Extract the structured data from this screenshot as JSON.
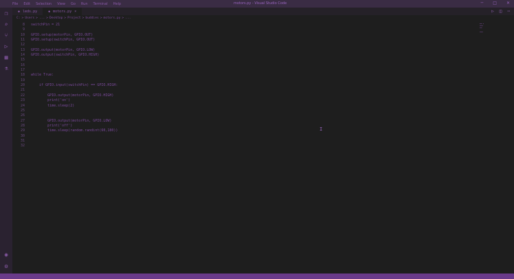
{
  "titlebar": {
    "menu": [
      "File",
      "Edit",
      "Selection",
      "View",
      "Go",
      "Run",
      "Terminal",
      "Help"
    ],
    "title": "motors.py - Visual Studio Code",
    "buttons": [
      "─",
      "□",
      "✕"
    ]
  },
  "tabs": [
    {
      "label": "leds.py",
      "active": false
    },
    {
      "label": "motors.py",
      "active": true
    }
  ],
  "breadcrumb": [
    "C:",
    "Users",
    "...",
    "Desktop",
    "Project",
    "buddies",
    "motors.py",
    "..."
  ],
  "editor": {
    "lines": [
      {
        "n": "8",
        "t": "switchPin = 21"
      },
      {
        "n": "9",
        "t": ""
      },
      {
        "n": "10",
        "t": "GPIO.setup(motorPin, GPIO.OUT)"
      },
      {
        "n": "11",
        "t": "GPIO.setup(switchPin, GPIO.OUT)"
      },
      {
        "n": "12",
        "t": ""
      },
      {
        "n": "13",
        "t": "GPIO.output(motorPin, GPIO.LOW)"
      },
      {
        "n": "14",
        "t": "GPIO.output(switchPin, GPIO.HIGH)"
      },
      {
        "n": "15",
        "t": ""
      },
      {
        "n": "16",
        "t": ""
      },
      {
        "n": "17",
        "t": ""
      },
      {
        "n": "18",
        "t": "while True:"
      },
      {
        "n": "19",
        "t": ""
      },
      {
        "n": "20",
        "t": "    if GPIO.input(switchPin) == GPIO.HIGH:"
      },
      {
        "n": "21",
        "t": ""
      },
      {
        "n": "22",
        "t": "        GPIO.output(motorPin, GPIO.HIGH)"
      },
      {
        "n": "23",
        "t": "        print('on')"
      },
      {
        "n": "24",
        "t": "        time.sleep(2)"
      },
      {
        "n": "25",
        "t": ""
      },
      {
        "n": "26",
        "t": ""
      },
      {
        "n": "27",
        "t": "        GPIO.output(motorPin, GPIO.LOW)"
      },
      {
        "n": "28",
        "t": "        print('off')"
      },
      {
        "n": "29",
        "t": "        time.sleep(random.randint(60,180))"
      },
      {
        "n": "30",
        "t": ""
      },
      {
        "n": "31",
        "t": ""
      },
      {
        "n": "32",
        "t": ""
      }
    ]
  }
}
